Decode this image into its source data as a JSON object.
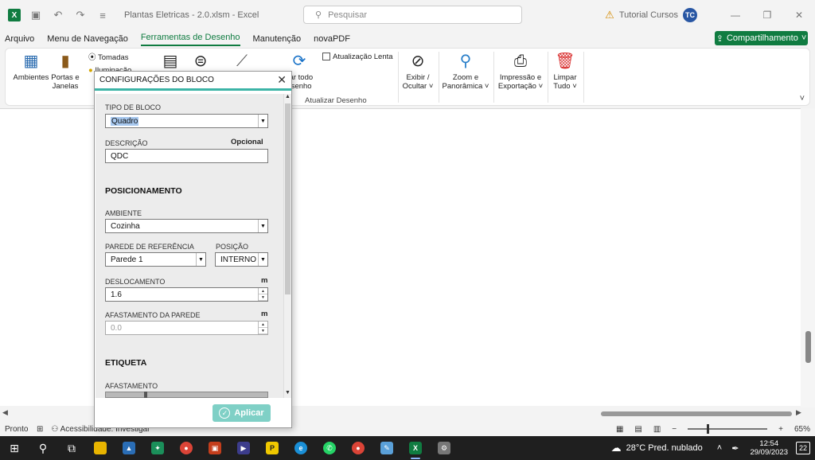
{
  "titlebar": {
    "doc_title": "Plantas Eletricas - 2.0.xlsm  -  Excel",
    "search_placeholder": "Pesquisar",
    "account": "Tutorial Cursos",
    "avatar_initials": "TC"
  },
  "menu": {
    "items": [
      "Arquivo",
      "Menu de Navegação",
      "Ferramentas de Desenho",
      "Manutenção",
      "novaPDF"
    ],
    "active_index": 2,
    "share_label": "Compartilhamento"
  },
  "ribbon": {
    "ambientes": "Ambientes",
    "portas_l1": "Portas e",
    "portas_l2": "Janelas",
    "tomadas": "Tomadas",
    "iluminacao": "Iluminação",
    "atualizar_todo_l1": "zar todo",
    "atualizar_todo_l2": "esenho",
    "atualizacao_lenta": "Atualização Lenta",
    "group_atualizar": "Atualizar Desenho",
    "exibir_l1": "Exibir /",
    "exibir_l2": "Ocultar ˅",
    "zoom_l1": "Zoom e",
    "zoom_l2": "Panorâmica ˅",
    "impressao_l1": "Impressão e",
    "impressao_l2": "Exportação ˅",
    "limpar_l1": "Limpar",
    "limpar_l2": "Tudo ˅"
  },
  "dialog": {
    "title": "CONFIGURAÇÕES DO BLOCO",
    "tipo_label": "TIPO DE BLOCO",
    "tipo_value": "Quadro",
    "descricao_label": "DESCRIÇÃO",
    "opcional": "Opcional",
    "descricao_value": "QDC",
    "posicionamento": "POSICIONAMENTO",
    "ambiente_label": "AMBIENTE",
    "ambiente_value": "Cozinha",
    "parede_label": "PAREDE DE REFERÊNCIA",
    "parede_value": "Parede 1",
    "posicao_label": "POSIÇÃO",
    "posicao_value": "INTERNO",
    "deslocamento_label": "DESLOCAMENTO",
    "deslocamento_unit": "m",
    "deslocamento_value": "1.6",
    "afastamento_parede_label": "AFASTAMENTO DA PAREDE",
    "afastamento_parede_unit": "m",
    "afastamento_parede_value": "0.0",
    "etiqueta": "ETIQUETA",
    "afastamento_label": "AFASTAMENTO",
    "apply_label": "Aplicar"
  },
  "statusbar": {
    "ready": "Pronto",
    "accessibility": "Acessibilidade: Investigar",
    "zoom": "65%"
  },
  "taskbar": {
    "weather": "28°C  Pred. nublado",
    "time": "12:54",
    "date": "29/09/2023",
    "notifications": "22"
  },
  "colors": {
    "excel_green": "#107c41",
    "dialog_accent": "#3cb4a6",
    "apply_button": "#7fd0c6"
  }
}
